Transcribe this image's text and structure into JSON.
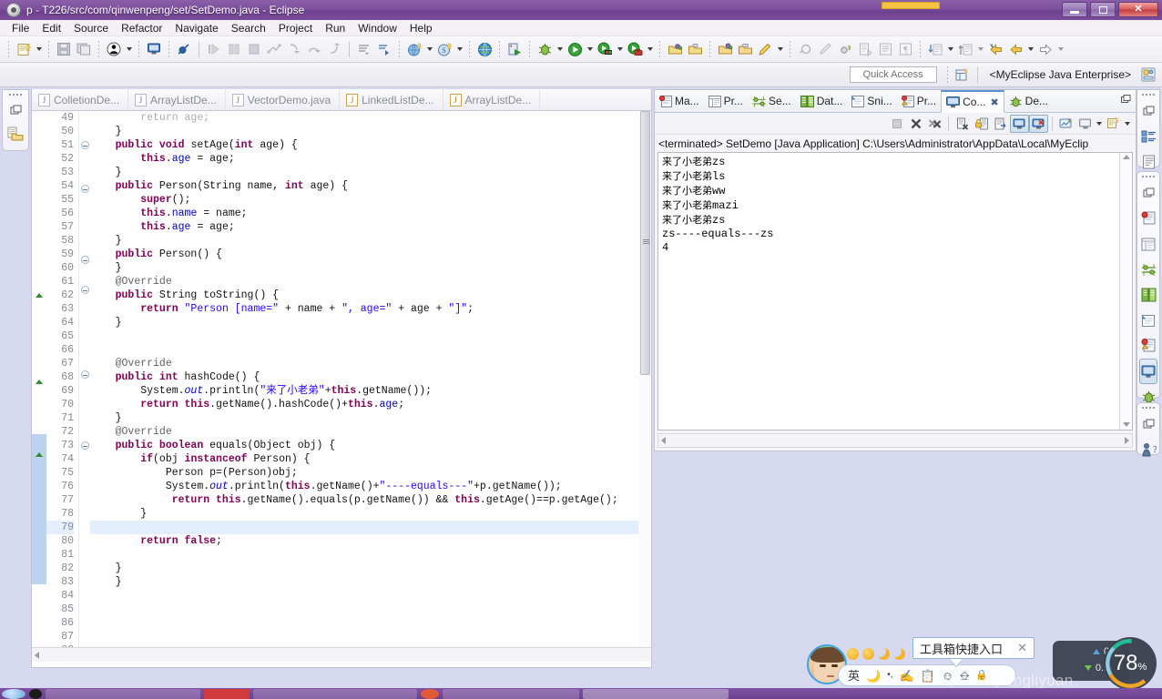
{
  "window": {
    "title": "p - T226/src/com/qinwenpeng/set/SetDemo.java - Eclipse",
    "minimize_label": "Minimize",
    "restore_label": "Restore",
    "close_label": "✕"
  },
  "menubar": {
    "items": [
      "File",
      "Edit",
      "Source",
      "Refactor",
      "Navigate",
      "Search",
      "Project",
      "Run",
      "Window",
      "Help"
    ]
  },
  "perspective": {
    "quick_access": "Quick Access",
    "current": "<MyEclipse Java Enterprise>"
  },
  "editor": {
    "tabs": [
      {
        "label": "ColletionDe...",
        "icon": "java-file-icon",
        "warn": false
      },
      {
        "label": "ArrayListDe...",
        "icon": "java-file-icon",
        "warn": false
      },
      {
        "label": "VectorDemo.java",
        "icon": "java-file-icon",
        "warn": false
      },
      {
        "label": "LinkedListDe...",
        "icon": "java-file-warning-icon",
        "warn": true
      },
      {
        "label": "ArrayListDe...",
        "icon": "java-file-warning-icon",
        "warn": true
      }
    ],
    "lines": [
      {
        "n": "49",
        "marker": "",
        "fold": "",
        "hl": false,
        "clipped": true,
        "tokens": [
          {
            "t": "        return age;",
            "c": ""
          }
        ]
      },
      {
        "n": "50",
        "marker": "",
        "fold": "",
        "hl": false,
        "tokens": [
          {
            "t": "    }",
            "c": ""
          }
        ]
      },
      {
        "n": "51",
        "marker": "",
        "fold": "minus",
        "hl": false,
        "tokens": [
          {
            "t": "    ",
            "c": ""
          },
          {
            "t": "public void ",
            "c": "kw"
          },
          {
            "t": "setAge(",
            "c": ""
          },
          {
            "t": "int ",
            "c": "kw"
          },
          {
            "t": "age) {",
            "c": ""
          }
        ]
      },
      {
        "n": "52",
        "marker": "",
        "fold": "",
        "hl": false,
        "tokens": [
          {
            "t": "        ",
            "c": ""
          },
          {
            "t": "this",
            "c": "kw"
          },
          {
            "t": ".",
            "c": ""
          },
          {
            "t": "age",
            "c": "fld"
          },
          {
            "t": " = age;",
            "c": ""
          }
        ]
      },
      {
        "n": "53",
        "marker": "",
        "fold": "",
        "hl": false,
        "tokens": [
          {
            "t": "    }",
            "c": ""
          }
        ]
      },
      {
        "n": "54",
        "marker": "",
        "fold": "minus",
        "hl": false,
        "tokens": [
          {
            "t": "    ",
            "c": ""
          },
          {
            "t": "public ",
            "c": "kw"
          },
          {
            "t": "Person(String name, ",
            "c": ""
          },
          {
            "t": "int ",
            "c": "kw"
          },
          {
            "t": "age) {",
            "c": ""
          }
        ]
      },
      {
        "n": "55",
        "marker": "",
        "fold": "",
        "hl": false,
        "tokens": [
          {
            "t": "        ",
            "c": ""
          },
          {
            "t": "super",
            "c": "kw"
          },
          {
            "t": "();",
            "c": ""
          }
        ]
      },
      {
        "n": "56",
        "marker": "",
        "fold": "",
        "hl": false,
        "tokens": [
          {
            "t": "        ",
            "c": ""
          },
          {
            "t": "this",
            "c": "kw"
          },
          {
            "t": ".",
            "c": ""
          },
          {
            "t": "name",
            "c": "fld"
          },
          {
            "t": " = name;",
            "c": ""
          }
        ]
      },
      {
        "n": "57",
        "marker": "",
        "fold": "",
        "hl": false,
        "tokens": [
          {
            "t": "        ",
            "c": ""
          },
          {
            "t": "this",
            "c": "kw"
          },
          {
            "t": ".",
            "c": ""
          },
          {
            "t": "age",
            "c": "fld"
          },
          {
            "t": " = age;",
            "c": ""
          }
        ]
      },
      {
        "n": "58",
        "marker": "",
        "fold": "",
        "hl": false,
        "tokens": [
          {
            "t": "    }",
            "c": ""
          }
        ]
      },
      {
        "n": "59",
        "marker": "",
        "fold": "minus",
        "hl": false,
        "tokens": [
          {
            "t": "    ",
            "c": ""
          },
          {
            "t": "public ",
            "c": "kw"
          },
          {
            "t": "Person() {",
            "c": ""
          }
        ]
      },
      {
        "n": "60",
        "marker": "",
        "fold": "",
        "hl": false,
        "tokens": [
          {
            "t": "    }",
            "c": ""
          }
        ]
      },
      {
        "n": "61",
        "marker": "",
        "fold": "minus",
        "hl": false,
        "tokens": [
          {
            "t": "    ",
            "c": ""
          },
          {
            "t": "@Override",
            "c": "ann"
          }
        ]
      },
      {
        "n": "62",
        "marker": "tri",
        "fold": "",
        "hl": false,
        "tokens": [
          {
            "t": "    ",
            "c": ""
          },
          {
            "t": "public ",
            "c": "kw"
          },
          {
            "t": "String toString() {",
            "c": ""
          }
        ]
      },
      {
        "n": "63",
        "marker": "",
        "fold": "",
        "hl": false,
        "tokens": [
          {
            "t": "        ",
            "c": ""
          },
          {
            "t": "return ",
            "c": "kw"
          },
          {
            "t": "\"Person [name=\"",
            "c": "str"
          },
          {
            "t": " + name + ",
            "c": ""
          },
          {
            "t": "\", age=\"",
            "c": "str"
          },
          {
            "t": " + age + ",
            "c": ""
          },
          {
            "t": "\"]\"",
            "c": "str"
          },
          {
            "t": ";",
            "c": ""
          }
        ]
      },
      {
        "n": "64",
        "marker": "",
        "fold": "",
        "hl": false,
        "tokens": [
          {
            "t": "    }",
            "c": ""
          }
        ]
      },
      {
        "n": "65",
        "marker": "",
        "fold": "",
        "hl": false,
        "tokens": [
          {
            "t": "",
            "c": ""
          }
        ]
      },
      {
        "n": "66",
        "marker": "",
        "fold": "",
        "hl": false,
        "tokens": [
          {
            "t": "",
            "c": ""
          }
        ]
      },
      {
        "n": "67",
        "marker": "",
        "fold": "minus",
        "hl": false,
        "tokens": [
          {
            "t": "    ",
            "c": ""
          },
          {
            "t": "@Override",
            "c": "ann"
          }
        ]
      },
      {
        "n": "68",
        "marker": "tri",
        "fold": "",
        "hl": false,
        "tokens": [
          {
            "t": "    ",
            "c": ""
          },
          {
            "t": "public int ",
            "c": "kw"
          },
          {
            "t": "hashCode() {",
            "c": ""
          }
        ]
      },
      {
        "n": "69",
        "marker": "",
        "fold": "",
        "hl": false,
        "tokens": [
          {
            "t": "        System.",
            "c": ""
          },
          {
            "t": "out",
            "c": "ital"
          },
          {
            "t": ".println(",
            "c": ""
          },
          {
            "t": "\"来了小老弟\"",
            "c": "str"
          },
          {
            "t": "+",
            "c": ""
          },
          {
            "t": "this",
            "c": "kw"
          },
          {
            "t": ".getName());",
            "c": ""
          }
        ]
      },
      {
        "n": "70",
        "marker": "",
        "fold": "",
        "hl": false,
        "tokens": [
          {
            "t": "        ",
            "c": ""
          },
          {
            "t": "return this",
            "c": "kw"
          },
          {
            "t": ".getName().hashCode()+",
            "c": ""
          },
          {
            "t": "this",
            "c": "kw"
          },
          {
            "t": ".",
            "c": ""
          },
          {
            "t": "age",
            "c": "fld"
          },
          {
            "t": ";",
            "c": ""
          }
        ]
      },
      {
        "n": "71",
        "marker": "",
        "fold": "",
        "hl": false,
        "tokens": [
          {
            "t": "    }",
            "c": ""
          }
        ]
      },
      {
        "n": "72",
        "marker": "blue",
        "fold": "minus",
        "hl": false,
        "tokens": [
          {
            "t": "    ",
            "c": ""
          },
          {
            "t": "@Override",
            "c": "ann"
          }
        ]
      },
      {
        "n": "73",
        "marker": "tri-blue",
        "fold": "",
        "hl": false,
        "tokens": [
          {
            "t": "    ",
            "c": ""
          },
          {
            "t": "public boolean ",
            "c": "kw"
          },
          {
            "t": "equals(Object obj) {",
            "c": ""
          }
        ]
      },
      {
        "n": "74",
        "marker": "blue",
        "fold": "",
        "hl": false,
        "tokens": [
          {
            "t": "        ",
            "c": ""
          },
          {
            "t": "if",
            "c": "kw"
          },
          {
            "t": "(obj ",
            "c": ""
          },
          {
            "t": "instanceof ",
            "c": "kw"
          },
          {
            "t": "Person) {",
            "c": ""
          }
        ]
      },
      {
        "n": "75",
        "marker": "blue",
        "fold": "",
        "hl": false,
        "tokens": [
          {
            "t": "            Person p=(Person)obj;",
            "c": ""
          }
        ]
      },
      {
        "n": "76",
        "marker": "blue",
        "fold": "",
        "hl": false,
        "tokens": [
          {
            "t": "            System.",
            "c": ""
          },
          {
            "t": "out",
            "c": "ital"
          },
          {
            "t": ".println(",
            "c": ""
          },
          {
            "t": "this",
            "c": "kw"
          },
          {
            "t": ".getName()+",
            "c": ""
          },
          {
            "t": "\"----equals---\"",
            "c": "str"
          },
          {
            "t": "+p.getName());",
            "c": ""
          }
        ]
      },
      {
        "n": "77",
        "marker": "blue",
        "fold": "",
        "hl": false,
        "tokens": [
          {
            "t": "             ",
            "c": ""
          },
          {
            "t": "return this",
            "c": "kw"
          },
          {
            "t": ".getName().equals(p.getName()) && ",
            "c": ""
          },
          {
            "t": "this",
            "c": "kw"
          },
          {
            "t": ".getAge()==p.getAge();",
            "c": ""
          }
        ]
      },
      {
        "n": "78",
        "marker": "blue",
        "fold": "",
        "hl": false,
        "tokens": [
          {
            "t": "        }",
            "c": ""
          }
        ]
      },
      {
        "n": "79",
        "marker": "blue",
        "fold": "",
        "hl": true,
        "tokens": [
          {
            "t": "",
            "c": ""
          }
        ]
      },
      {
        "n": "80",
        "marker": "blue",
        "fold": "",
        "hl": false,
        "tokens": [
          {
            "t": "        ",
            "c": ""
          },
          {
            "t": "return false",
            "c": "kw"
          },
          {
            "t": ";",
            "c": ""
          }
        ]
      },
      {
        "n": "81",
        "marker": "blue",
        "fold": "",
        "hl": false,
        "tokens": [
          {
            "t": "",
            "c": ""
          }
        ]
      },
      {
        "n": "82",
        "marker": "blue",
        "fold": "",
        "hl": false,
        "tokens": [
          {
            "t": "    }",
            "c": ""
          }
        ]
      },
      {
        "n": "83",
        "marker": "",
        "fold": "",
        "hl": false,
        "tokens": [
          {
            "t": "    }",
            "c": ""
          }
        ]
      },
      {
        "n": "84",
        "marker": "",
        "fold": "",
        "hl": false,
        "tokens": [
          {
            "t": "",
            "c": ""
          }
        ]
      },
      {
        "n": "85",
        "marker": "",
        "fold": "",
        "hl": false,
        "tokens": [
          {
            "t": "",
            "c": ""
          }
        ]
      },
      {
        "n": "86",
        "marker": "",
        "fold": "",
        "hl": false,
        "tokens": [
          {
            "t": "",
            "c": ""
          }
        ]
      },
      {
        "n": "87",
        "marker": "",
        "fold": "",
        "hl": false,
        "tokens": [
          {
            "t": "",
            "c": ""
          }
        ]
      },
      {
        "n": "88",
        "marker": "",
        "fold": "",
        "hl": false,
        "tokens": [
          {
            "t": "",
            "c": ""
          }
        ]
      }
    ]
  },
  "console_panel": {
    "tabs": [
      {
        "label": "Ma...",
        "icon": "markers-icon",
        "active": false
      },
      {
        "label": "Pr...",
        "icon": "properties-icon",
        "active": false
      },
      {
        "label": "Se...",
        "icon": "servers-icon",
        "active": false
      },
      {
        "label": "Dat...",
        "icon": "data-source-icon",
        "active": false
      },
      {
        "label": "Sni...",
        "icon": "snippets-icon",
        "active": false
      },
      {
        "label": "Pr...",
        "icon": "problems-icon",
        "active": false
      },
      {
        "label": "Co...",
        "icon": "console-icon",
        "active": true
      },
      {
        "label": "De...",
        "icon": "debug-icon",
        "active": false
      }
    ],
    "close_glyph": "✖",
    "restore_glyph": "❐",
    "launch_line": "<terminated> SetDemo [Java Application] C:\\Users\\Administrator\\AppData\\Local\\MyEclip",
    "output": [
      "来了小老弟zs",
      "来了小老弟ls",
      "来了小老弟ww",
      "来了小老弟mazi",
      "来了小老弟zs",
      "zs----equals---zs",
      "4"
    ]
  },
  "ime": {
    "tooltip_text": "工具箱快捷入口",
    "tooltip_close": "✕",
    "lang_label": "英",
    "icons": [
      "moon-icon",
      "punctuation-icon",
      "pen-icon",
      "clipboard-icon",
      "emoji-icon",
      "keyboard-icon",
      "lock-icon"
    ]
  },
  "system_monitor": {
    "upload": "0K/s",
    "download": "0.1K/s",
    "cpu_value": "78",
    "cpu_unit": "%"
  },
  "watermark": "net/qinwenpengliyuan",
  "colors": {
    "title_purple": "#7d4f9c",
    "accent_blue": "#5a8fd0",
    "keyword": "#7f0055",
    "string": "#2a00ff",
    "field": "#0000c0",
    "annotation": "#646464"
  }
}
